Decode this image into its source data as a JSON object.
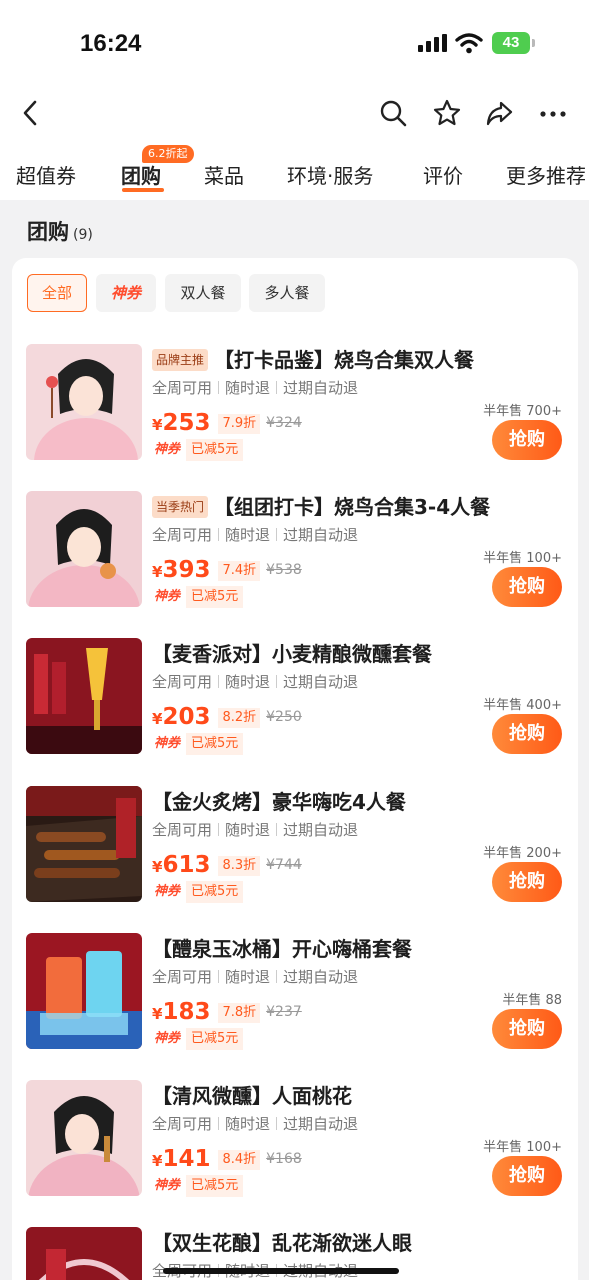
{
  "status_bar": {
    "time": "16:24",
    "battery": "43"
  },
  "nav": {
    "icons": [
      "back-icon",
      "search-icon",
      "star-icon",
      "share-icon",
      "more-icon"
    ]
  },
  "tabs": {
    "items": [
      "超值券",
      "团购",
      "菜品",
      "环境·服务",
      "评价",
      "更多推荐"
    ],
    "active": "团购",
    "badge": "6.2折起"
  },
  "section": {
    "title": "团购",
    "count": "(9)"
  },
  "filters": [
    "全部",
    "神券",
    "双人餐",
    "多人餐"
  ],
  "labels": {
    "currency": "¥",
    "buy": "抢购",
    "shenquan": "神券",
    "coupon_text": "已减5元"
  },
  "deals": [
    {
      "tag": "品牌主推",
      "name": "【打卡品鉴】烧鸟合集双人餐",
      "features": [
        "全周可用",
        "随时退",
        "过期自动退"
      ],
      "price": "253",
      "discount": "7.9折",
      "original": "¥324",
      "sold": "半年售 700+"
    },
    {
      "tag": "当季热门",
      "name": "【组团打卡】烧鸟合集3-4人餐",
      "features": [
        "全周可用",
        "随时退",
        "过期自动退"
      ],
      "price": "393",
      "discount": "7.4折",
      "original": "¥538",
      "sold": "半年售 100+"
    },
    {
      "tag": "",
      "name": "【麦香派对】小麦精酿微醺套餐",
      "features": [
        "全周可用",
        "随时退",
        "过期自动退"
      ],
      "price": "203",
      "discount": "8.2折",
      "original": "¥250",
      "sold": "半年售 400+"
    },
    {
      "tag": "",
      "name": "【金火炙烤】豪华嗨吃4人餐",
      "features": [
        "全周可用",
        "随时退",
        "过期自动退"
      ],
      "price": "613",
      "discount": "8.3折",
      "original": "¥744",
      "sold": "半年售 200+"
    },
    {
      "tag": "",
      "name": "【醴泉玉冰桶】开心嗨桶套餐",
      "features": [
        "全周可用",
        "随时退",
        "过期自动退"
      ],
      "price": "183",
      "discount": "7.8折",
      "original": "¥237",
      "sold": "半年售 88"
    },
    {
      "tag": "",
      "name": "【清风微醺】人面桃花",
      "features": [
        "全周可用",
        "随时退",
        "过期自动退"
      ],
      "price": "141",
      "discount": "8.4折",
      "original": "¥168",
      "sold": "半年售 100+"
    },
    {
      "tag": "",
      "name": "【双生花酿】乱花渐欲迷人眼",
      "features": [
        "全周可用",
        "随时退",
        "过期自动退"
      ]
    }
  ]
}
